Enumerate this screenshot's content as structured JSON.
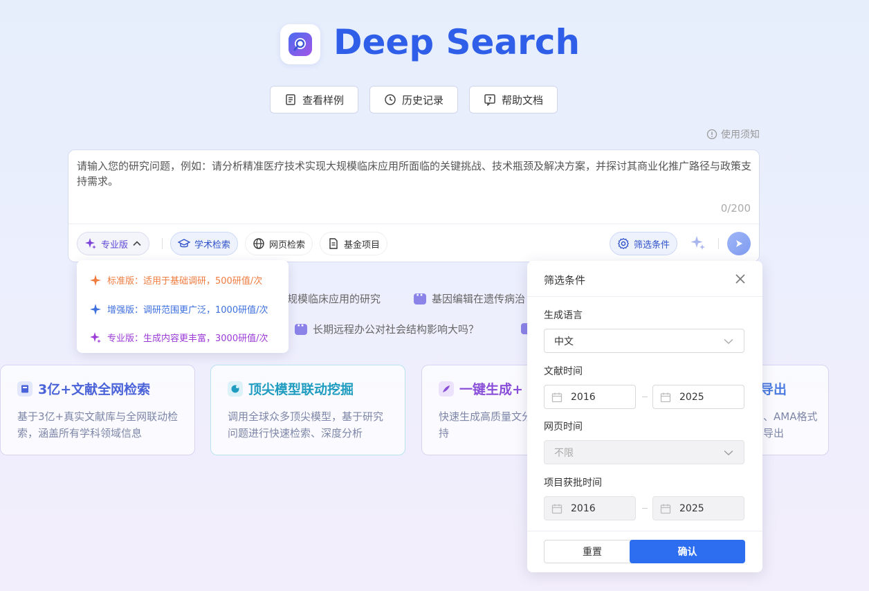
{
  "brand": {
    "name": "Deep Search"
  },
  "top_buttons": [
    {
      "label": "查看样例",
      "icon": "document-icon"
    },
    {
      "label": "历史记录",
      "icon": "clock-icon"
    },
    {
      "label": "帮助文档",
      "icon": "help-icon"
    }
  ],
  "notice": "使用须知",
  "input": {
    "placeholder": "请输入您的研究问题，例如：请分析精准医疗技术实现大规模临床应用所面临的关键挑战、技术瓶颈及解决方案，并探讨其商业化推广路径与政策支持需求。",
    "counter": "0/200"
  },
  "toolbar": {
    "tier": "专业版",
    "academic": "学术检索",
    "web": "网页检索",
    "fund": "基金项目",
    "filter": "筛选条件"
  },
  "tier_menu": [
    {
      "label": "标准版：适用于基础调研，500研值/次",
      "color": "#f07b3f"
    },
    {
      "label": "增强版：调研范围更广泛，1000研值/次",
      "color": "#3d6fe0"
    },
    {
      "label": "专业版：生成内容更丰富，3000研值/次",
      "color": "#9b3ad8"
    }
  ],
  "suggestions": [
    "规模临床应用的研究",
    "基因编辑在遗传病治",
    "长期远程办公对社会结构影响大吗？"
  ],
  "features": [
    {
      "title": "3亿+文献全网检索",
      "desc": "基于3亿+真实文献库与全网联动检索，涵盖所有学科领域信息",
      "color": "#4b63d9"
    },
    {
      "title": "顶尖模型联动挖掘",
      "desc": "调用全球众多顶尖模型，基于研究问题进行快速检索、深度分析",
      "color": "#1f9cc0"
    },
    {
      "title": "一键生成+",
      "desc": "快速生成高质量文分析等报告，支持",
      "color": "#8a4fd8"
    },
    {
      "title": "导出",
      "desc": "、AMA格式导出",
      "color": "#4b7be0"
    }
  ],
  "filter_panel": {
    "title": "筛选条件",
    "language_label": "生成语言",
    "language_value": "中文",
    "lit_time_label": "文献时间",
    "lit_from": "2016",
    "lit_to": "2025",
    "web_time_label": "网页时间",
    "web_time_value": "不限",
    "project_time_label": "项目获批时间",
    "project_from": "2016",
    "project_to": "2025",
    "reset": "重置",
    "confirm": "确认"
  }
}
